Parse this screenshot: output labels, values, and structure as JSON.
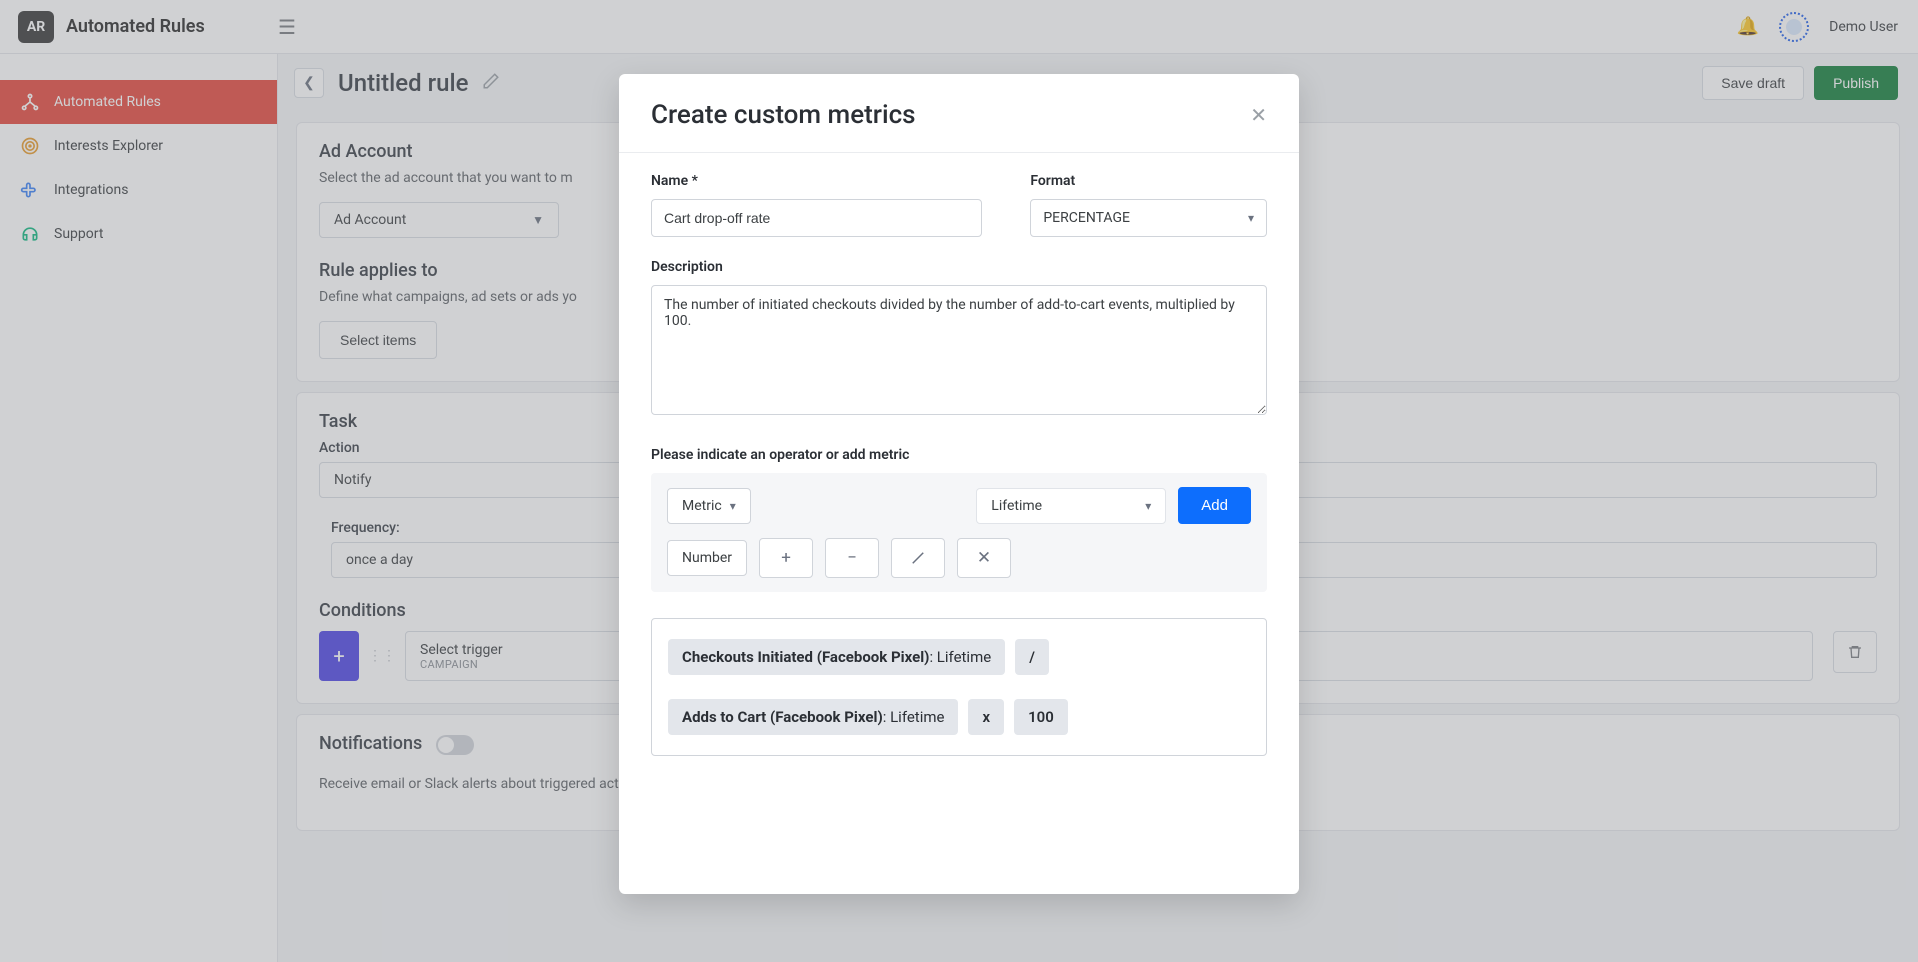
{
  "topbar": {
    "logo_text": "AR",
    "app_title": "Automated Rules",
    "user_name": "Demo User"
  },
  "sidebar": {
    "items": [
      {
        "label": "Automated Rules",
        "icon": "tree-icon",
        "active": true
      },
      {
        "label": "Interests Explorer",
        "icon": "target-icon",
        "active": false
      },
      {
        "label": "Integrations",
        "icon": "puzzle-icon",
        "active": false
      },
      {
        "label": "Support",
        "icon": "headset-icon",
        "active": false
      }
    ]
  },
  "page": {
    "title": "Untitled rule",
    "save_draft_label": "Save draft",
    "publish_label": "Publish"
  },
  "cards": {
    "ad_account": {
      "title": "Ad Account",
      "subtitle": "Select the ad account that you want to m",
      "selector_label": "Ad Account"
    },
    "applies": {
      "title": "Rule applies to",
      "subtitle": "Define what campaigns, ad sets or ads yo",
      "button_label": "Select items"
    },
    "task": {
      "title": "Task",
      "action_label": "Action",
      "action_value": "Notify",
      "frequency_label": "Frequency:",
      "frequency_value": "once a day"
    },
    "conditions": {
      "title": "Conditions",
      "trigger_label": "Select trigger",
      "trigger_sub": "CAMPAIGN"
    },
    "notifications": {
      "title": "Notifications",
      "subtitle": "Receive email or Slack alerts about triggered actions and errors."
    }
  },
  "modal": {
    "title": "Create custom metrics",
    "name_label": "Name *",
    "name_value": "Cart drop-off rate",
    "format_label": "Format",
    "format_value": "PERCENTAGE",
    "description_label": "Description",
    "description_value": "The number of initiated checkouts divided by the number of add-to-cart events, multiplied by 100.",
    "indicate_label": "Please indicate an operator or add metric",
    "metric_label": "Metric",
    "lifetime_label": "Lifetime",
    "add_label": "Add",
    "number_label": "Number",
    "formula": {
      "tok1_main": "Checkouts Initiated (Facebook Pixel)",
      "tok1_suffix": ": Lifetime",
      "tok2": "/",
      "tok3_main": "Adds to Cart (Facebook Pixel)",
      "tok3_suffix": ": Lifetime",
      "tok4": "x",
      "tok5": "100"
    }
  }
}
